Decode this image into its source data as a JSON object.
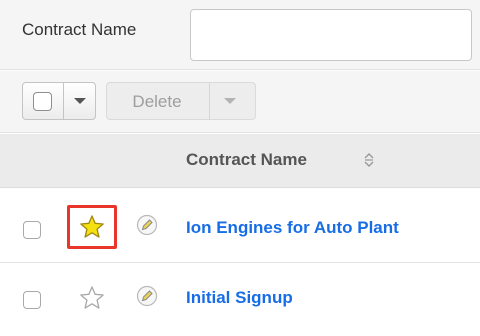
{
  "filter": {
    "label": "Contract Name",
    "value": "",
    "placeholder": ""
  },
  "actions": {
    "delete_label": "Delete"
  },
  "table": {
    "column_header": "Contract Name",
    "rows": [
      {
        "name": "Ion Engines for Auto Plant",
        "favorite": true
      },
      {
        "name": "Initial Signup",
        "favorite": false
      }
    ]
  },
  "colors": {
    "link": "#176de5",
    "favorite_star": "#f5e10f",
    "highlight": "#e8362a"
  }
}
